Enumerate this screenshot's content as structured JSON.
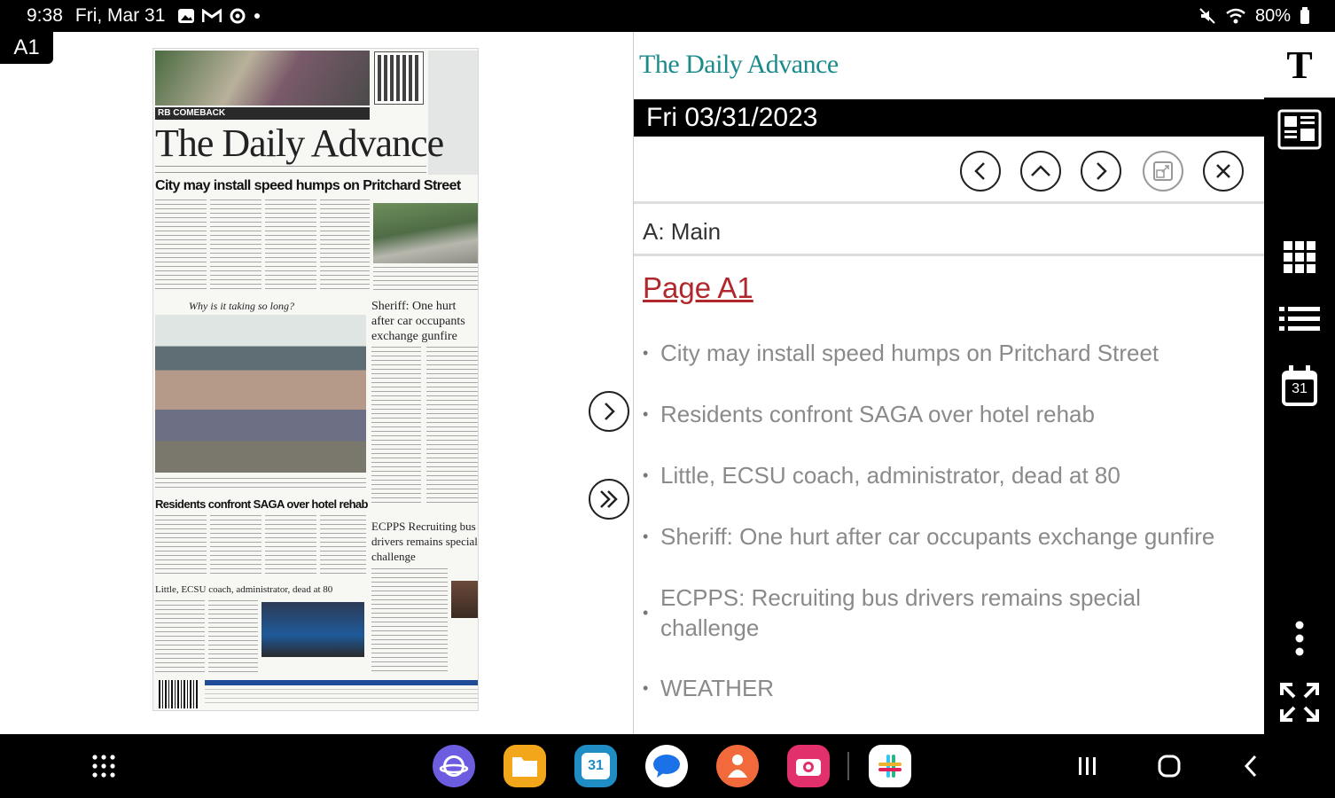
{
  "status_bar": {
    "time": "9:38",
    "date": "Fri, Mar 31",
    "battery": "80%"
  },
  "page_label": "A1",
  "newspaper": {
    "strip_text": "RB COMEBACK",
    "masthead": "The Daily Advance",
    "headline_1": "City may install speed humps on Pritchard Street",
    "photo_caption": "Why is it taking so long?",
    "side_headline": "Sheriff: One hurt after car occupants exchange gunfire",
    "headline_2": "Residents confront SAGA over hotel rehab",
    "side_headline_2": "ECPPS Recruiting bus drivers remains special challenge",
    "headline_3": "Little, ECSU coach, administrator, dead at 80"
  },
  "reader": {
    "logo": "The Daily Advance",
    "date": "Fri 03/31/2023",
    "section": "A: Main",
    "page_link": "Page A1",
    "articles": [
      "City may install speed humps on Pritchard Street",
      "Residents confront SAGA over hotel rehab",
      "Little, ECSU coach, administrator, dead at 80",
      "Sheriff: One hurt after car occupants exchange gunfire",
      "ECPPS: Recruiting bus drivers remains special challenge",
      "WEATHER"
    ]
  },
  "toolbar": {
    "text_size_label": "T",
    "calendar_day": "31"
  },
  "dock": {
    "calendar_day": "31"
  },
  "colors": {
    "logo_teal": "#1a8a8a",
    "page_link_red": "#b0282d"
  }
}
